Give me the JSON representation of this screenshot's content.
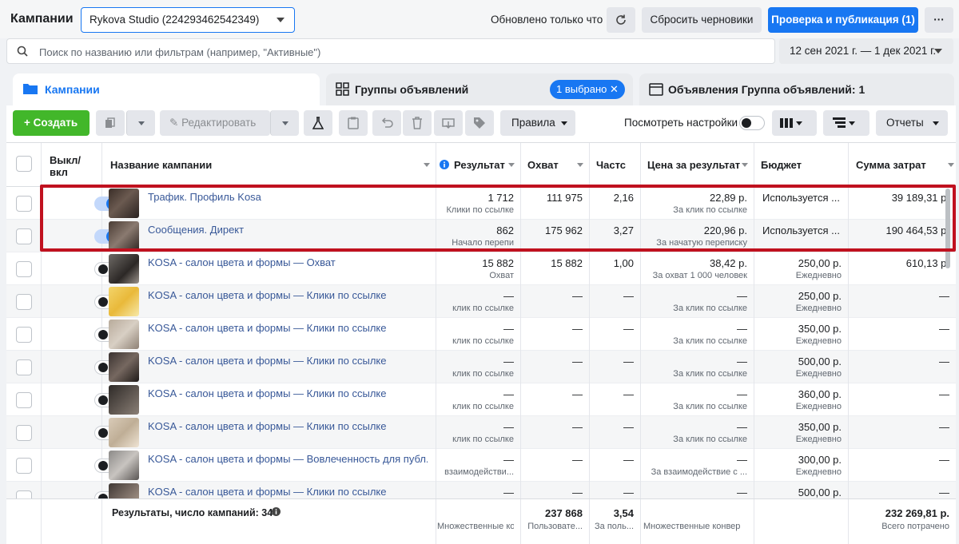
{
  "header": {
    "title": "Кампании",
    "account": "Rykova Studio (224293462542349)",
    "updated": "Обновлено только что",
    "reset_label": "Сбросить черновики",
    "publish_label": "Проверка и публикация (1)",
    "more_label": "···"
  },
  "search": {
    "placeholder": "Поиск по названию или фильтрам (например, \"Активные\")",
    "date_range": "12 сен 2021 г. — 1 дек 2021 г."
  },
  "tabs": {
    "campaigns": "Кампании",
    "adsets": "Группы объявлений",
    "selected_chip": "1 выбрано ✕",
    "ads": "Объявления Группа объявлений: 1"
  },
  "toolbar": {
    "create": "Создать",
    "edit": "Редактировать",
    "rules": "Правила",
    "view_settings": "Посмотреть настройки",
    "reports": "Отчеты"
  },
  "columns": {
    "onoff": "Выкл/\nвкл",
    "name": "Название кампании",
    "result": "Результат",
    "reach": "Охват",
    "freq": "Частс",
    "cpr": "Цена за результат",
    "budget": "Бюджет",
    "spent": "Сумма затрат"
  },
  "rows": [
    {
      "name": "Трафик. Профиль Kosa",
      "on": true,
      "result": "1 712",
      "result_sub": "Клики по ссылке",
      "reach": "111 975",
      "freq": "2,16",
      "cpr": "22,89 р.",
      "cpr_sub": "За клик по ссылке",
      "budget": "Используется ...",
      "budget_sub": "",
      "spent": "39 189,31 р."
    },
    {
      "name": "Сообщения. Директ",
      "on": true,
      "result": "862",
      "result_sub": "Начало перепи",
      "reach": "175 962",
      "freq": "3,27",
      "cpr": "220,96 р.",
      "cpr_sub": "За начатую переписку",
      "budget": "Используется ...",
      "budget_sub": "",
      "spent": "190 464,53 р."
    },
    {
      "name": "KOSA - салон цвета и формы — Охват",
      "on": false,
      "result": "15 882",
      "result_sub": "Охват",
      "reach": "15 882",
      "freq": "1,00",
      "cpr": "38,42 р.",
      "cpr_sub": "За охват 1 000 человек",
      "budget": "250,00 р.",
      "budget_sub": "Ежедневно",
      "spent": "610,13 р."
    },
    {
      "name": "KOSA - салон цвета и формы — Клики по ссылке",
      "on": false,
      "result": "—",
      "result_sub": "клик по ссылке",
      "reach": "—",
      "freq": "—",
      "cpr": "—",
      "cpr_sub": "За клик по ссылке",
      "budget": "250,00 р.",
      "budget_sub": "Ежедневно",
      "spent": "—"
    },
    {
      "name": "KOSA - салон цвета и формы — Клики по ссылке",
      "on": false,
      "result": "—",
      "result_sub": "клик по ссылке",
      "reach": "—",
      "freq": "—",
      "cpr": "—",
      "cpr_sub": "За клик по ссылке",
      "budget": "350,00 р.",
      "budget_sub": "Ежедневно",
      "spent": "—"
    },
    {
      "name": "KOSA - салон цвета и формы — Клики по ссылке",
      "on": false,
      "result": "—",
      "result_sub": "клик по ссылке",
      "reach": "—",
      "freq": "—",
      "cpr": "—",
      "cpr_sub": "За клик по ссылке",
      "budget": "500,00 р.",
      "budget_sub": "Ежедневно",
      "spent": "—"
    },
    {
      "name": "KOSA - салон цвета и формы — Клики по ссылке",
      "on": false,
      "result": "—",
      "result_sub": "клик по ссылке",
      "reach": "—",
      "freq": "—",
      "cpr": "—",
      "cpr_sub": "За клик по ссылке",
      "budget": "360,00 р.",
      "budget_sub": "Ежедневно",
      "spent": "—"
    },
    {
      "name": "KOSA - салон цвета и формы — Клики по ссылке",
      "on": false,
      "result": "—",
      "result_sub": "клик по ссылке",
      "reach": "—",
      "freq": "—",
      "cpr": "—",
      "cpr_sub": "За клик по ссылке",
      "budget": "350,00 р.",
      "budget_sub": "Ежедневно",
      "spent": "—"
    },
    {
      "name": "KOSA - салон цвета и формы — Вовлеченность для публ...",
      "on": false,
      "result": "—",
      "result_sub": "взаимодействи...",
      "reach": "—",
      "freq": "—",
      "cpr": "—",
      "cpr_sub": "За взаимодействие с ...",
      "budget": "300,00 р.",
      "budget_sub": "Ежедневно",
      "spent": "—"
    },
    {
      "name": "KOSA - салон цвета и формы — Клики по ссылке",
      "on": false,
      "result": "—",
      "result_sub": "",
      "reach": "—",
      "freq": "—",
      "cpr": "—",
      "cpr_sub": "",
      "budget": "500,00 р.",
      "budget_sub": "",
      "spent": "—"
    }
  ],
  "footer": {
    "label": "Результаты, число кампаний: 34",
    "result_sub": "Множественные ко",
    "reach": "237 868",
    "reach_sub": "Пользовате...",
    "freq": "3,54",
    "freq_sub": "За поль...",
    "cpr_sub": "Множественные конвер",
    "spent": "232 269,81 р.",
    "spent_sub": "Всего потрачено"
  },
  "colors": {
    "accent": "#1877f2",
    "create": "#42b72a",
    "highlight": "#c0111f"
  }
}
